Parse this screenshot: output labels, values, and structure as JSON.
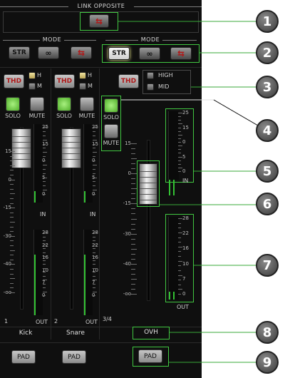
{
  "header": {
    "link_opposite": "LINK OPPOSITE"
  },
  "mode_label": "MODE",
  "mode_buttons": {
    "str": "STR"
  },
  "thd_label": "THD",
  "hm": {
    "h": "H",
    "m": "M"
  },
  "high_mid": {
    "high": "HIGH",
    "mid": "MID"
  },
  "solo": "SOLO",
  "mute": "MUTE",
  "in_label": "IN",
  "out_label": "OUT",
  "fader_scale": [
    "15",
    "0",
    "-15",
    "-30",
    "-40",
    "-oo"
  ],
  "in_scale": [
    "25",
    "15",
    "0",
    "5",
    "0"
  ],
  "out_scale": [
    "28",
    "22",
    "16",
    "10",
    "7",
    "0"
  ],
  "big_fader_scale": [
    "15",
    "0",
    "-15",
    "-30",
    "-40",
    "-oo"
  ],
  "big_in_scale": [
    "25",
    "15",
    "0",
    "5",
    "0"
  ],
  "big_out_scale": [
    "28",
    "22",
    "16",
    "10",
    "7",
    "0"
  ],
  "channels": [
    {
      "number": "1",
      "name": "Kick"
    },
    {
      "number": "2",
      "name": "Snare"
    },
    {
      "number": "3/4",
      "name": "OVH"
    }
  ],
  "pad_label": "PAD",
  "callouts": [
    "1",
    "2",
    "3",
    "4",
    "5",
    "6",
    "7",
    "8",
    "9"
  ],
  "colors": {
    "accent_green": "#41c741",
    "background": "#0f0f0f",
    "thd_red": "#b01818"
  }
}
